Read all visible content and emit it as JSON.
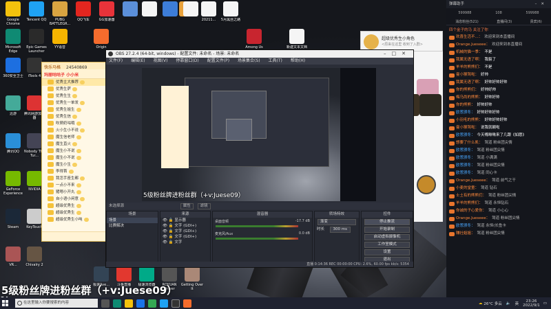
{
  "desktop": {
    "icons": [
      {
        "label": "Google Chrome",
        "color": "#f4c20d"
      },
      {
        "label": "Tencent QQ",
        "color": "#1fa2f3"
      },
      {
        "label": "PUBG BATTLEGR...",
        "color": "#d9a441"
      },
      {
        "label": "QQ飞车",
        "color": "#e3261f"
      },
      {
        "label": "GG加速器",
        "color": "#e8333a"
      },
      {
        "label": "",
        "color": "#5b8fd9"
      },
      {
        "label": "",
        "color": "#f5f5f5"
      },
      {
        "label": "",
        "color": "#3d7dd8"
      },
      {
        "label": "",
        "color": "#e9a23b"
      },
      {
        "label": "",
        "color": "#f5f5f5"
      },
      {
        "label": "20211...",
        "color": "#f5f5f5"
      },
      {
        "label": "5月黑丝之路",
        "color": "#f5f5f5"
      },
      {
        "label": "Microsoft Edge",
        "color": "#0f8a73"
      },
      {
        "label": "Epic Games Launcher",
        "color": "#2a2a2a"
      },
      {
        "label": "YY语音",
        "color": "#f5b400"
      },
      {
        "label": "Origin",
        "color": "#f56c2d"
      },
      {
        "label": "Among Us",
        "color": "#c8252f"
      },
      {
        "label": "新建文本文档",
        "color": "#f5f5f5"
      }
    ],
    "left_column": [
      "360安全卫士",
      "iTools 4",
      "迅游",
      "腾讯网游加速器",
      "腾讯QQ",
      "Nobody The Tur...",
      "GeForce Experience",
      "NVIDIA",
      "Steam",
      "KeyTouch",
      "VR...",
      "Chivalry 2",
      "极速Ave...",
      "斗鱼直播",
      "极速浏览器",
      "ROYUAN Driver",
      "Getting Over It"
    ],
    "caption": "5级粉丝牌进粉丝群（+v:Juese09）",
    "badge": "24"
  },
  "fan_panel": {
    "title": "快乐马格",
    "id": "24540869",
    "subtitle": "玛丽咕咕子 小小米",
    "rows": [
      "优秀主大推荐",
      "优秀生萨",
      "优秀生生",
      "优秀生一单发",
      "优秀生姐生",
      "优秀生信",
      "吹萌奶咕哦",
      "火小生小不说",
      "魔生信老师",
      "魔生直火",
      "魔生小不说",
      "魔生小不说",
      "魔生小生",
      "李得首",
      "我怎手座生都",
      "一点小不来",
      "猪嗯小开丸",
      "自小语小闲意",
      "超级优秀生",
      "超级优秀生",
      "超级优秀生小吨"
    ]
  },
  "obs": {
    "title": "OBS 27.2.4 (64-bit, windows) - 配置文件: 未命名 - 场景: 未命名",
    "menu": [
      "文件(F)",
      "编辑(E)",
      "视图(V)",
      "停靠窗口(D)",
      "配置文件(P)",
      "场景集合(S)",
      "工具(T)",
      "帮助(H)"
    ],
    "preview_overlay": "5级粉丝牌进粉丝群（+v:Juese09）",
    "control_bar": {
      "label": "未选择源",
      "properties": "属性",
      "filters": "滤镜"
    },
    "scenes": {
      "header": "场景",
      "items": [
        "场景",
        "比赛解决"
      ]
    },
    "sources": {
      "header": "来源",
      "items": [
        "显示器",
        "文字 (GDI+)",
        "文字 (GDI+)",
        "文字 (GDI+)",
        "文字"
      ]
    },
    "mixer": {
      "header": "混音器",
      "channels": [
        {
          "name": "桌面音频",
          "level": "-17.7 dB"
        },
        {
          "name": "麦克风/Aux",
          "level": "0.0 dB"
        }
      ]
    },
    "transitions": {
      "header": "转场特效",
      "mode": "渐变",
      "duration_label": "时长",
      "duration": "300 ms"
    },
    "controls": {
      "header": "控件",
      "buttons": [
        "停止推流",
        "开始录制",
        "启动虚拟摄像机",
        "工作室模式",
        "设置",
        "退出"
      ]
    },
    "status": "直播 0:14:36  REC 00:00:00  CPU: 2.6%, 60.00 fps  kb/s: 5354"
  },
  "qq_popup": {
    "name": "超级优秀生小角色",
    "message": "<原来在这里  收到了入群>"
  },
  "chat": {
    "header": "弹幕助手",
    "stats": [
      "599988",
      "108",
      "599988"
    ],
    "tabs": [
      "消息粉丝(521)",
      "直播间(3)",
      "贵宾(6)"
    ],
    "welcome": "四个金子的马 关注了你",
    "messages": [
      {
        "name": "欢喜生活不...",
        "text": "欢迎来到本直播间",
        "sys": true,
        "blue": false
      },
      {
        "name": "Orange.Jueseee",
        "text": "欢迎来到本直播间",
        "sys": true,
        "blue": false
      },
      {
        "name": "机械的猫一季",
        "text": "不是",
        "sys": false,
        "blue": false
      },
      {
        "name": "我属无语了啊",
        "text": "我裂了",
        "sys": false,
        "blue": false
      },
      {
        "name": "羊羊的熊熊们",
        "text": "不是",
        "sys": false,
        "blue": false
      },
      {
        "name": "曼小猴驾啦",
        "text": "好帅",
        "sys": false,
        "blue": false
      },
      {
        "name": "我属无语了啊",
        "text": "好帅好帅好帅",
        "sys": false,
        "blue": false
      },
      {
        "name": "你的熊熊们",
        "text": "好帅好帅",
        "sys": false,
        "blue": false
      },
      {
        "name": "梅乌尚的熊熊",
        "text": "好帅好帅",
        "sys": false,
        "blue": false
      },
      {
        "name": "你的熊熊",
        "text": "好帅好帅",
        "sys": false,
        "blue": false
      },
      {
        "name": "欧葱颁冬",
        "text": "好帅好帅好帅",
        "sys": false,
        "blue": true
      },
      {
        "name": "小羽毛的熊熊",
        "text": "好帅好帅好帅",
        "sys": false,
        "blue": false
      },
      {
        "name": "曼小猴驾啦",
        "text": "说我就躺啦",
        "sys": false,
        "blue": false
      },
      {
        "name": "欧葱颁冬",
        "text": "今天嘴啾啾来了几跟《如愿》",
        "sys": false,
        "blue": true
      },
      {
        "name": "想要了什么凯",
        "text": "驾道 粉丝团尖情",
        "sys": true,
        "blue": false
      },
      {
        "name": "欧葱颁冬",
        "text": "驾道 粉丝团尖情",
        "sys": true,
        "blue": true
      },
      {
        "name": "欧葱颁冬",
        "text": "驾道 小满满",
        "sys": true,
        "blue": true
      },
      {
        "name": "欧葱颁冬",
        "text": "驾道 粉丝团尖情",
        "sys": true,
        "blue": true
      },
      {
        "name": "欧葱颁冬",
        "text": "驾道 同心卡",
        "sys": true,
        "blue": true
      },
      {
        "name": "Orange.Jueseee",
        "text": "驾道 前气之干",
        "sys": true,
        "blue": false
      },
      {
        "name": "小麦的堂童",
        "text": "驾道 钻石",
        "sys": true,
        "blue": false
      },
      {
        "name": "士土有的熊熊们",
        "text": "驾道 粉丝团尖情",
        "sys": true,
        "blue": false
      },
      {
        "name": "羊羊的熊熊们",
        "text": "驾道 永恒钻石",
        "sys": true,
        "blue": false
      },
      {
        "name": "你诚的子心爱你",
        "text": "驾道 小心心",
        "sys": true,
        "blue": false
      },
      {
        "name": "Orange.Jueseee",
        "text": "驾道 粉丝团尖情",
        "sys": true,
        "blue": false
      },
      {
        "name": "欧葱颁冬",
        "text": "驾道 永恒(长鱼卡",
        "sys": true,
        "blue": true
      },
      {
        "name": "赚社姐姐",
        "text": "驾道 粉丝团尖情",
        "sys": true,
        "blue": false
      }
    ]
  },
  "taskbar": {
    "search_placeholder": "在这里输入你要搜索的内容",
    "weather": "26°C 多云",
    "time": "23:26",
    "date": "2022/9/1",
    "ime": "英"
  }
}
